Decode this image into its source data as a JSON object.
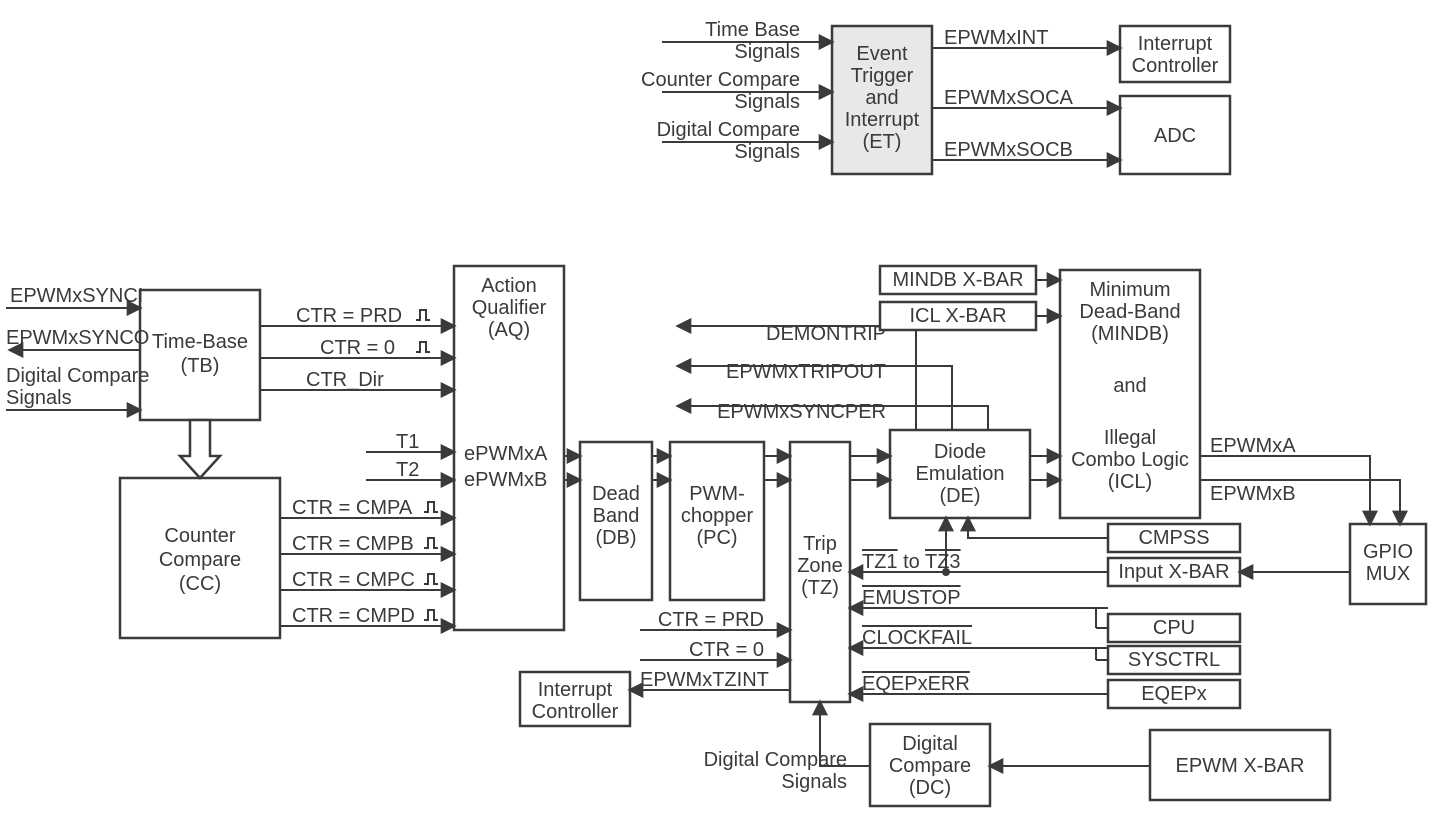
{
  "top": {
    "inputs": [
      "Time Base",
      "Signals",
      "Counter Compare",
      "Signals",
      "Digital Compare",
      "Signals"
    ],
    "et": [
      "Event",
      "Trigger",
      "and",
      "Interrupt",
      "(ET)"
    ],
    "out1": "EPWMxINT",
    "out2": "EPWMxSOCA",
    "out3": "EPWMxSOCB",
    "intctrl": [
      "Interrupt",
      "Controller"
    ],
    "adc": "ADC"
  },
  "left": {
    "sig1": "EPWMxSYNCI",
    "sig2": "EPWMxSYNCO",
    "sig3": [
      "Digital Compare",
      "Signals"
    ],
    "tb": [
      "Time-Base",
      "(TB)"
    ],
    "cc": [
      "Counter",
      "Compare",
      "(CC)"
    ],
    "tbout": [
      "CTR = PRD",
      "CTR = 0",
      "CTR_Dir"
    ],
    "ccout": [
      "CTR = CMPA",
      "CTR = CMPB",
      "CTR = CMPC",
      "CTR = CMPD"
    ],
    "t1": "T1",
    "t2": "T2"
  },
  "mid": {
    "aq": [
      "Action",
      "Qualifier",
      "(AQ)"
    ],
    "aq_ports": [
      "ePWMxA",
      "ePWMxB"
    ],
    "db": [
      "Dead",
      "Band",
      "(DB)"
    ],
    "pc": [
      "PWM-",
      "chopper",
      "(PC)"
    ],
    "tz": [
      "Trip",
      "Zone",
      "(TZ)"
    ],
    "tz_in1": "CTR = PRD",
    "tz_in2": "CTR = 0",
    "tzint": "EPWMxTZINT",
    "intctrl2": [
      "Interrupt",
      "Controller"
    ]
  },
  "right": {
    "mindb_bar": "MINDB X-BAR",
    "icl_bar": "ICL X-BAR",
    "mindb": [
      "Minimum",
      "Dead-Band",
      "(MINDB)",
      "",
      "and",
      "",
      "Illegal",
      "Combo Logic",
      "(ICL)"
    ],
    "de": [
      "Diode",
      "Emulation",
      "(DE)"
    ],
    "de_in1": "DEMONTRIP",
    "de_in2": "EPWMxTRIPOUT",
    "de_in3": "EPWMxSYNCPER",
    "outA": "EPWMxA",
    "outB": "EPWMxB",
    "cmpss": "CMPSS",
    "inputxbar": "Input X-BAR",
    "cpu": "CPU",
    "sysctrl": "SYSCTRL",
    "eqepx": "EQEPx",
    "gpio": [
      "GPIO",
      "MUX"
    ],
    "tz_sig1a": "TZ1",
    "tz_sig1b": " to ",
    "tz_sig1c": "TZ3",
    "tz_sig2": "EMUSTOP",
    "tz_sig3": "CLOCKFAIL",
    "tz_sig4": "EQEPxERR"
  },
  "bottom": {
    "dc": [
      "Digital",
      "Compare",
      "(DC)"
    ],
    "dcsig": [
      "Digital Compare",
      "Signals"
    ],
    "epwmxbar": "EPWM X-BAR"
  }
}
